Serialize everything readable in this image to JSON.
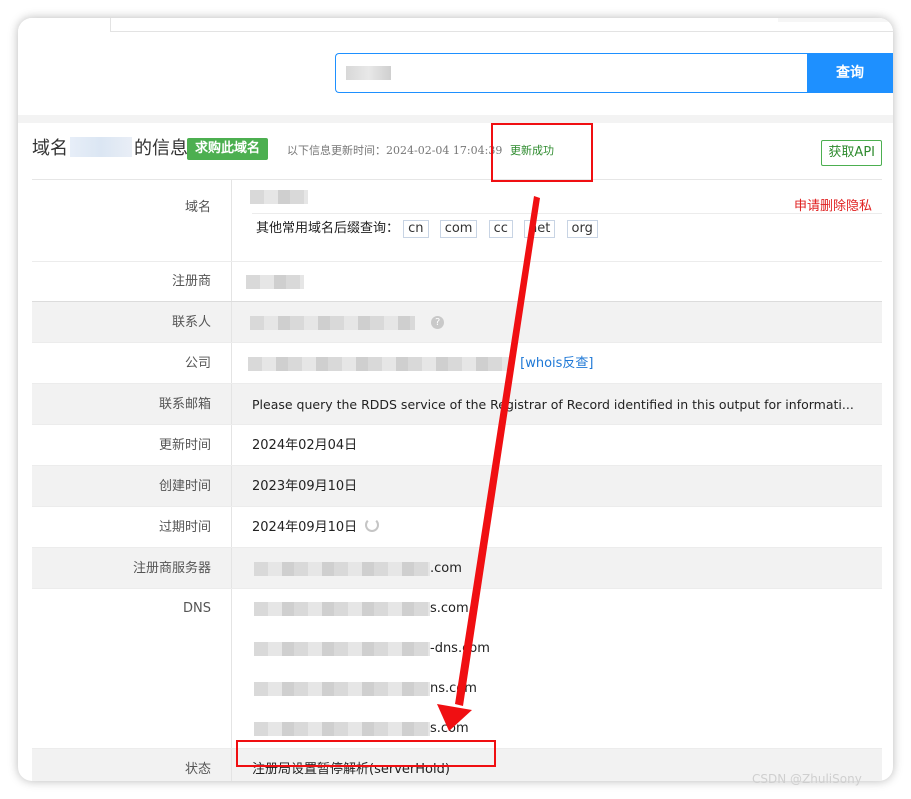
{
  "search": {
    "query_masked": "",
    "button_label": "查询"
  },
  "header": {
    "title_prefix": "域名",
    "title_suffix": "的信息",
    "buy_button": "求购此域名",
    "update_label": "以下信息更新时间：2024-02-04 17:04:39",
    "update_status": "更新成功",
    "api_button": "获取API"
  },
  "rows": {
    "domain": {
      "label": "域名",
      "remove_privacy": "申请删除隐私",
      "suffix_query_label": "其他常用域名后缀查询：",
      "suffixes": [
        "cn",
        "com",
        "cc",
        "net",
        "org"
      ]
    },
    "registrar": {
      "label": "注册商"
    },
    "contact": {
      "label": "联系人"
    },
    "company": {
      "label": "公司",
      "whois_link": "[whois反查]"
    },
    "email": {
      "label": "联系邮箱",
      "value": "Please query the RDDS service of the Registrar of Record identified in this output for informati..."
    },
    "updated": {
      "label": "更新时间",
      "value": "2024年02月04日"
    },
    "created": {
      "label": "创建时间",
      "value": "2023年09月10日"
    },
    "expires": {
      "label": "过期时间",
      "value": "2024年09月10日"
    },
    "registrar_server": {
      "label": "注册商服务器",
      "value_tail": ".com"
    },
    "dns": {
      "label": "DNS",
      "values_tail": [
        "s.com",
        "-dns.com",
        "ns.com",
        "s.com"
      ]
    },
    "status": {
      "label": "状态",
      "value": "注册局设置暂停解析(serverHold)"
    }
  },
  "watermark": "CSDN @ZhuliSony",
  "colors": {
    "primary": "#1e90ff",
    "green": "#4caf50",
    "annotation_red": "#f00f12"
  },
  "icons": [
    "help-icon",
    "refresh-icon",
    "annotation-arrow"
  ]
}
